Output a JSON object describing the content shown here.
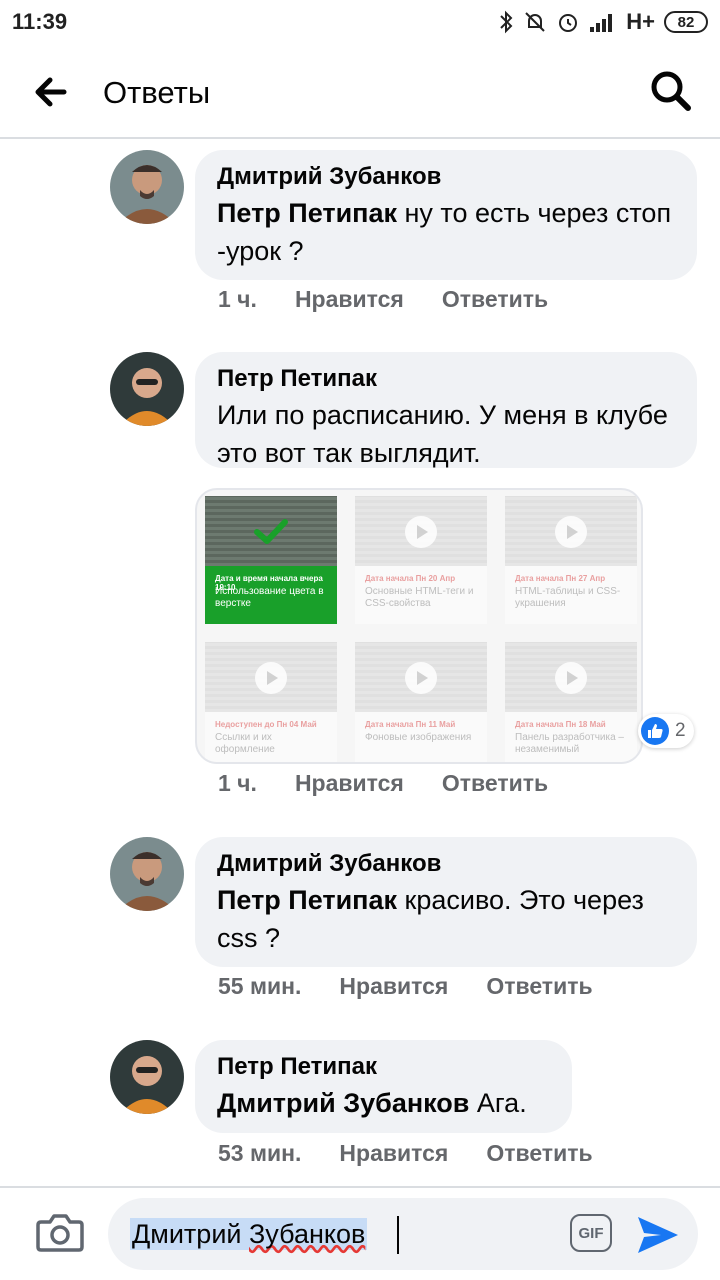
{
  "status_bar": {
    "time": "11:39",
    "network": "H+",
    "battery": "82"
  },
  "header": {
    "title": "Ответы"
  },
  "comments": [
    {
      "author": "Дмитрий Зубанков",
      "mention": "Петр Петипак",
      "text": " ну то есть через стоп -урок ?",
      "time": "1 ч.",
      "like_label": "Нравится",
      "reply_label": "Ответить"
    },
    {
      "author": "Петр Петипак",
      "text": "Или по расписанию. У меня в клубе это вот так выглядит.",
      "time": "1 ч.",
      "like_label": "Нравится",
      "reply_label": "Ответить",
      "reactions": {
        "type": "like",
        "count": "2"
      },
      "attachment": {
        "tiles": [
          {
            "date": "Дата и время начала вчера 19:10",
            "name": "Использование цвета в верстке",
            "state": "done"
          },
          {
            "date": "Дата начала Пн 20 Апр",
            "name": "Основные HTML-теги и CSS-свойства",
            "state": "locked"
          },
          {
            "date": "Дата начала Пн 27 Апр",
            "name": "HTML-таблицы и CSS-украшения",
            "state": "locked"
          },
          {
            "date": "Недоступен до Пн 04 Май",
            "name": "Ссылки и их оформление",
            "state": "locked"
          },
          {
            "date": "Дата начала Пн 11 Май",
            "name": "Фоновые изображения",
            "state": "locked"
          },
          {
            "date": "Дата начала Пн 18 Май",
            "name": "Панель разработчика – незаменимый",
            "state": "locked"
          }
        ]
      }
    },
    {
      "author": "Дмитрий Зубанков",
      "mention": "Петр Петипак",
      "text": " красиво. Это через css ?",
      "time": "55 мин.",
      "like_label": "Нравится",
      "reply_label": "Ответить"
    },
    {
      "author": "Петр Петипак",
      "mention": "Дмитрий Зубанков",
      "text": " Ага.",
      "time": "53 мин.",
      "like_label": "Нравится",
      "reply_label": "Ответить"
    }
  ],
  "composer": {
    "first_name": "Дмитрий",
    "last_name": "Зубанков",
    "gif_label": "GIF"
  },
  "colors": {
    "accent": "#1877f2",
    "bubble": "#f0f2f5",
    "meta": "#65676b",
    "done_tile": "#19a02a"
  },
  "icons": [
    "back-arrow-icon",
    "search-icon",
    "camera-icon",
    "gif-icon",
    "send-icon",
    "like-icon",
    "checkmark-icon",
    "play-icon"
  ]
}
